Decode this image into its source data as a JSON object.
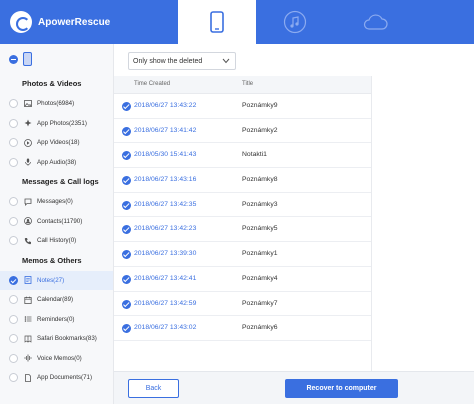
{
  "app": {
    "name": "ApowerRescue"
  },
  "colors": {
    "accent": "#3a6fe0",
    "header": "#3a6fe0",
    "active_bg": "#e6eefb"
  },
  "device_tabs": [
    {
      "icon": "phone-icon",
      "active": true
    },
    {
      "icon": "music-icon",
      "active": false
    },
    {
      "icon": "cloud-icon",
      "active": false
    }
  ],
  "sidebar": {
    "sections": [
      {
        "heading": "Photos & Videos",
        "items": [
          {
            "label": "Photos(6984)",
            "icon": "photo-icon",
            "checked": false,
            "active": false
          },
          {
            "label": "App Photos(2351)",
            "icon": "app-photos-icon",
            "checked": false,
            "active": false
          },
          {
            "label": "App Videos(18)",
            "icon": "play-icon",
            "checked": false,
            "active": false
          },
          {
            "label": "App Audio(38)",
            "icon": "microphone-icon",
            "checked": false,
            "active": false
          }
        ]
      },
      {
        "heading": "Messages & Call logs",
        "items": [
          {
            "label": "Messages(0)",
            "icon": "message-icon",
            "checked": false,
            "active": false
          },
          {
            "label": "Contacts(11790)",
            "icon": "contacts-icon",
            "checked": false,
            "active": false
          },
          {
            "label": "Call History(0)",
            "icon": "phone-call-icon",
            "checked": false,
            "active": false
          }
        ]
      },
      {
        "heading": "Memos & Others",
        "items": [
          {
            "label": "Notes(27)",
            "icon": "notes-icon",
            "checked": true,
            "active": true
          },
          {
            "label": "Calendar(89)",
            "icon": "calendar-icon",
            "checked": false,
            "active": false
          },
          {
            "label": "Reminders(0)",
            "icon": "reminders-icon",
            "checked": false,
            "active": false
          },
          {
            "label": "Safari Bookmarks(83)",
            "icon": "bookmark-icon",
            "checked": false,
            "active": false
          },
          {
            "label": "Voice Memos(0)",
            "icon": "voice-memo-icon",
            "checked": false,
            "active": false
          },
          {
            "label": "App Documents(71)",
            "icon": "document-icon",
            "checked": false,
            "active": false
          }
        ]
      }
    ]
  },
  "filter": {
    "selected": "Only show the deleted"
  },
  "table": {
    "columns": [
      "Time Created",
      "Title"
    ],
    "rows": [
      {
        "time": "2018/06/27 13:43:22",
        "title": "Poznámky9"
      },
      {
        "time": "2018/06/27 13:41:42",
        "title": "Poznámky2"
      },
      {
        "time": "2018/05/30 15:41:43",
        "title": "Notakti1"
      },
      {
        "time": "2018/06/27 13:43:16",
        "title": "Poznámky8"
      },
      {
        "time": "2018/06/27 13:42:35",
        "title": "Poznámky3"
      },
      {
        "time": "2018/06/27 13:42:23",
        "title": "Poznámky5"
      },
      {
        "time": "2018/06/27 13:39:30",
        "title": "Poznámky1"
      },
      {
        "time": "2018/06/27 13:42:41",
        "title": "Poznámky4"
      },
      {
        "time": "2018/06/27 13:42:59",
        "title": "Poznámky7"
      },
      {
        "time": "2018/06/27 13:43:02",
        "title": "Poznámky6"
      }
    ]
  },
  "footer": {
    "back_label": "Back",
    "recover_label": "Recover to computer"
  }
}
